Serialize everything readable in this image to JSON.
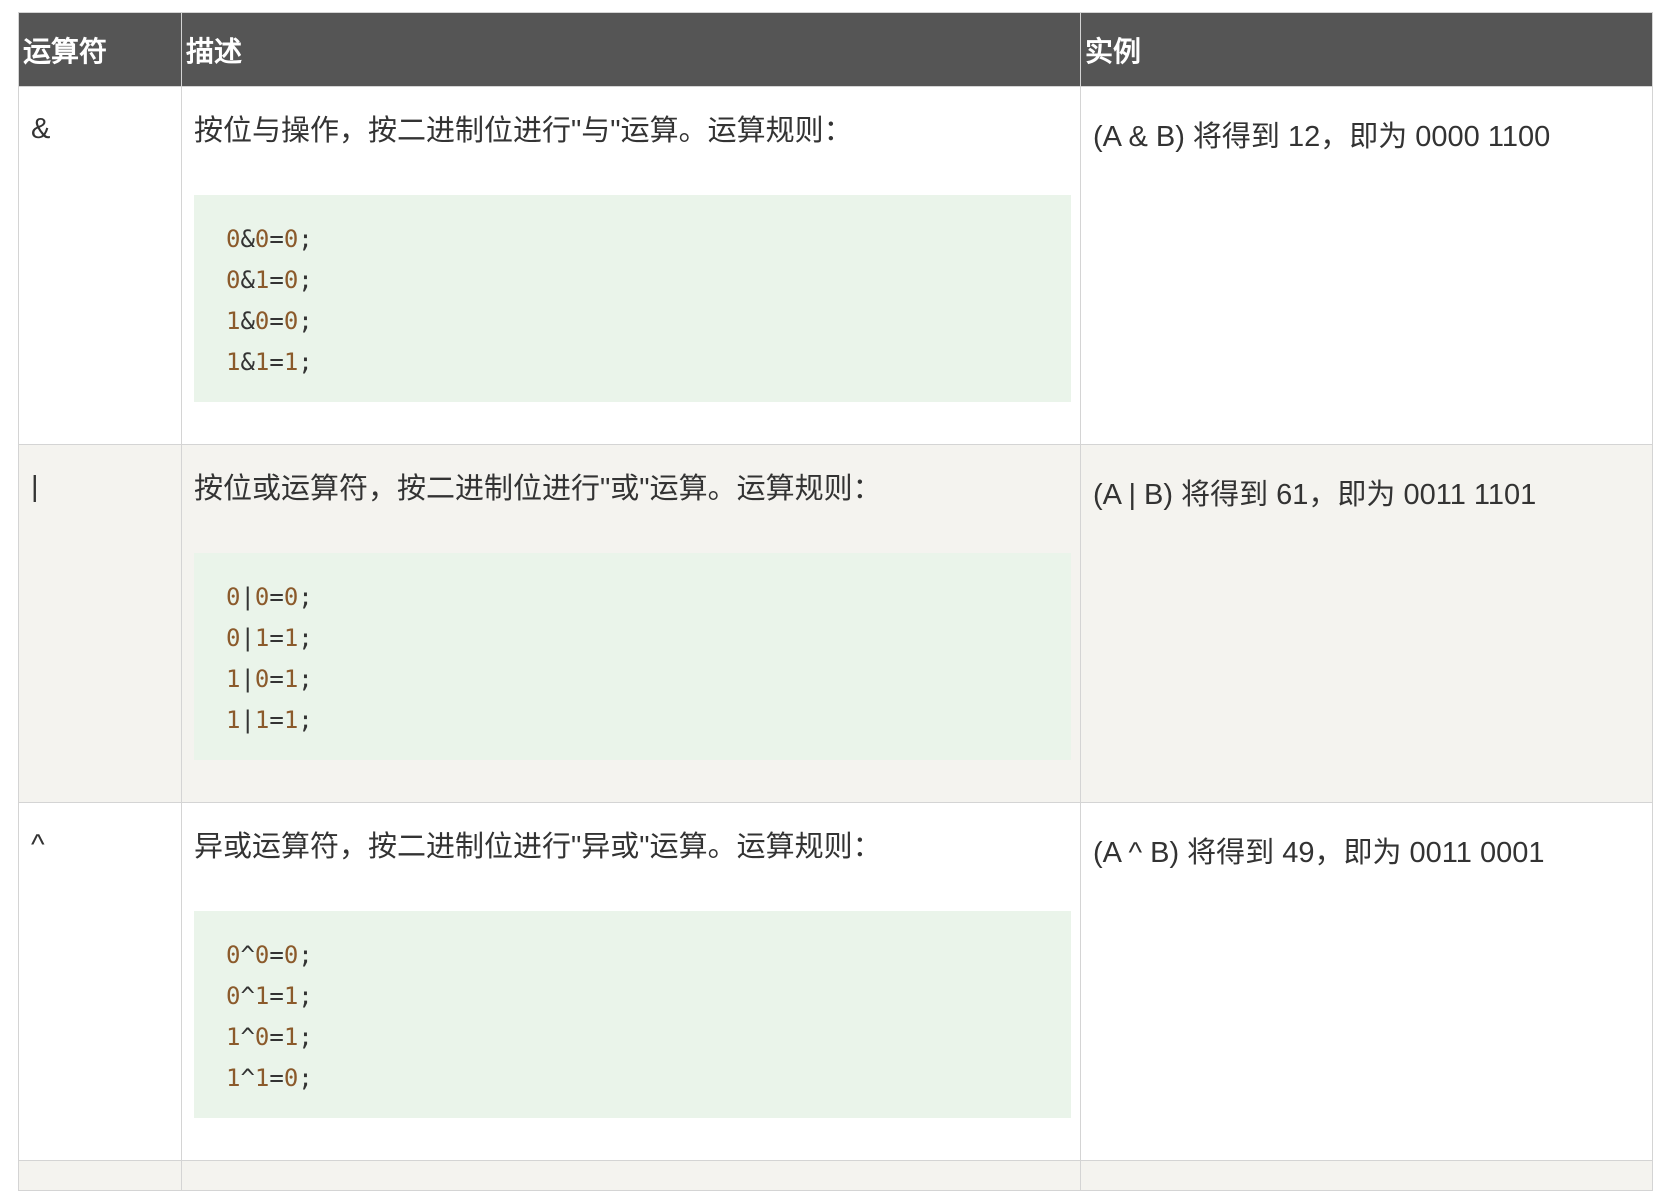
{
  "table": {
    "headers": [
      "运算符",
      "描述",
      "实例"
    ],
    "rows": [
      {
        "operator": "&",
        "description": "按位与操作，按二进制位进行\"与\"运算。运算规则：",
        "rules": [
          {
            "a": "0",
            "op": "&",
            "b": "0",
            "eq": "=",
            "r": "0",
            "end": ";"
          },
          {
            "a": "0",
            "op": "&",
            "b": "1",
            "eq": "=",
            "r": "0",
            "end": ";"
          },
          {
            "a": "1",
            "op": "&",
            "b": "0",
            "eq": "=",
            "r": "0",
            "end": ";"
          },
          {
            "a": "1",
            "op": "&",
            "b": "1",
            "eq": "=",
            "r": "1",
            "end": ";"
          }
        ],
        "example": "(A & B) 将得到 12，即为 0000 1100"
      },
      {
        "operator": "|",
        "description": "按位或运算符，按二进制位进行\"或\"运算。运算规则：",
        "rules": [
          {
            "a": "0",
            "op": "|",
            "b": "0",
            "eq": "=",
            "r": "0",
            "end": ";"
          },
          {
            "a": "0",
            "op": "|",
            "b": "1",
            "eq": "=",
            "r": "1",
            "end": ";"
          },
          {
            "a": "1",
            "op": "|",
            "b": "0",
            "eq": "=",
            "r": "1",
            "end": ";"
          },
          {
            "a": "1",
            "op": "|",
            "b": "1",
            "eq": "=",
            "r": "1",
            "end": ";"
          }
        ],
        "example": "(A | B) 将得到 61，即为 0011 1101"
      },
      {
        "operator": "^",
        "description": "异或运算符，按二进制位进行\"异或\"运算。运算规则：",
        "rules": [
          {
            "a": "0",
            "op": "^",
            "b": "0",
            "eq": "=",
            "r": "0",
            "end": ";"
          },
          {
            "a": "0",
            "op": "^",
            "b": "1",
            "eq": "=",
            "r": "1",
            "end": ";"
          },
          {
            "a": "1",
            "op": "^",
            "b": "0",
            "eq": "=",
            "r": "1",
            "end": ";"
          },
          {
            "a": "1",
            "op": "^",
            "b": "1",
            "eq": "=",
            "r": "0",
            "end": ";"
          }
        ],
        "example": "(A ^ B) 将得到 49，即为 0011 0001"
      }
    ]
  },
  "colors": {
    "header_bg": "#555555",
    "header_text": "#ffffff",
    "row_alt_bg": "#f4f3ef",
    "code_bg": "#eaf4ea",
    "code_number": "#8b5a2b",
    "border": "#d4d4d4"
  }
}
